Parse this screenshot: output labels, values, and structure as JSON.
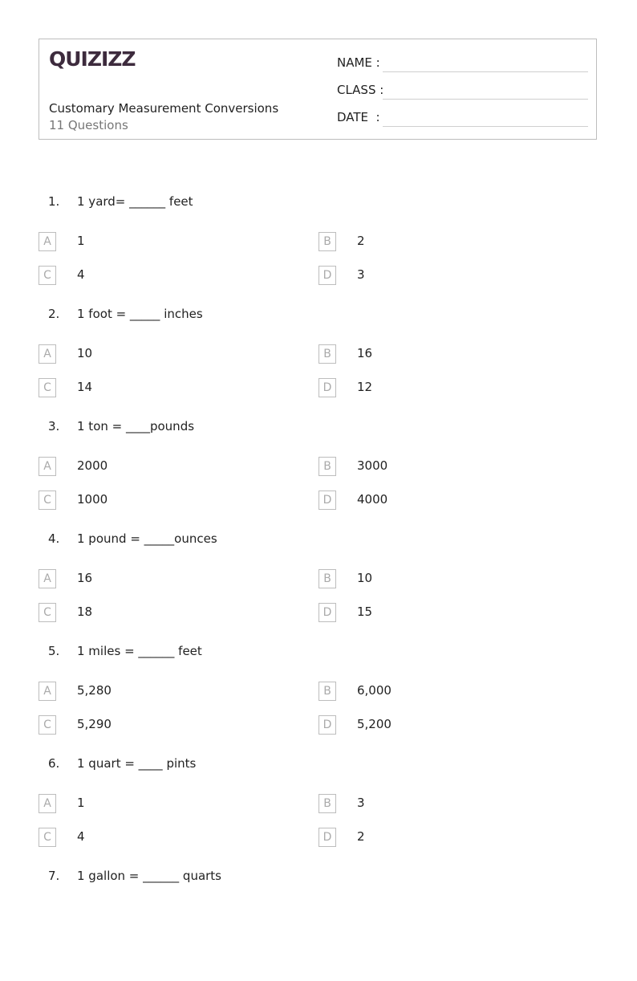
{
  "header": {
    "logo": "QUIZIZZ",
    "title": "Customary Measurement Conversions",
    "subtitle": "11 Questions",
    "fields": [
      {
        "label": "NAME :"
      },
      {
        "label": "CLASS :"
      },
      {
        "label": "DATE  :"
      }
    ]
  },
  "questions": [
    {
      "number": "1.",
      "text": "1 yard= ______ feet",
      "options": [
        {
          "letter": "A",
          "text": "1"
        },
        {
          "letter": "B",
          "text": "2"
        },
        {
          "letter": "C",
          "text": "4"
        },
        {
          "letter": "D",
          "text": "3"
        }
      ]
    },
    {
      "number": "2.",
      "text": "1 foot = _____ inches",
      "options": [
        {
          "letter": "A",
          "text": "10"
        },
        {
          "letter": "B",
          "text": "16"
        },
        {
          "letter": "C",
          "text": "14"
        },
        {
          "letter": "D",
          "text": "12"
        }
      ]
    },
    {
      "number": "3.",
      "text": "1 ton = ____pounds",
      "options": [
        {
          "letter": "A",
          "text": "2000"
        },
        {
          "letter": "B",
          "text": "3000"
        },
        {
          "letter": "C",
          "text": "1000"
        },
        {
          "letter": "D",
          "text": "4000"
        }
      ]
    },
    {
      "number": "4.",
      "text": "1 pound = _____ounces",
      "options": [
        {
          "letter": "A",
          "text": "16"
        },
        {
          "letter": "B",
          "text": "10"
        },
        {
          "letter": "C",
          "text": "18"
        },
        {
          "letter": "D",
          "text": "15"
        }
      ]
    },
    {
      "number": "5.",
      "text": "1 miles = ______ feet",
      "options": [
        {
          "letter": "A",
          "text": "5,280"
        },
        {
          "letter": "B",
          "text": "6,000"
        },
        {
          "letter": "C",
          "text": "5,290"
        },
        {
          "letter": "D",
          "text": "5,200"
        }
      ]
    },
    {
      "number": "6.",
      "text": "1 quart = ____ pints",
      "options": [
        {
          "letter": "A",
          "text": "1"
        },
        {
          "letter": "B",
          "text": "3"
        },
        {
          "letter": "C",
          "text": "4"
        },
        {
          "letter": "D",
          "text": "2"
        }
      ]
    },
    {
      "number": "7.",
      "text": "1 gallon = ______ quarts",
      "options": []
    }
  ]
}
